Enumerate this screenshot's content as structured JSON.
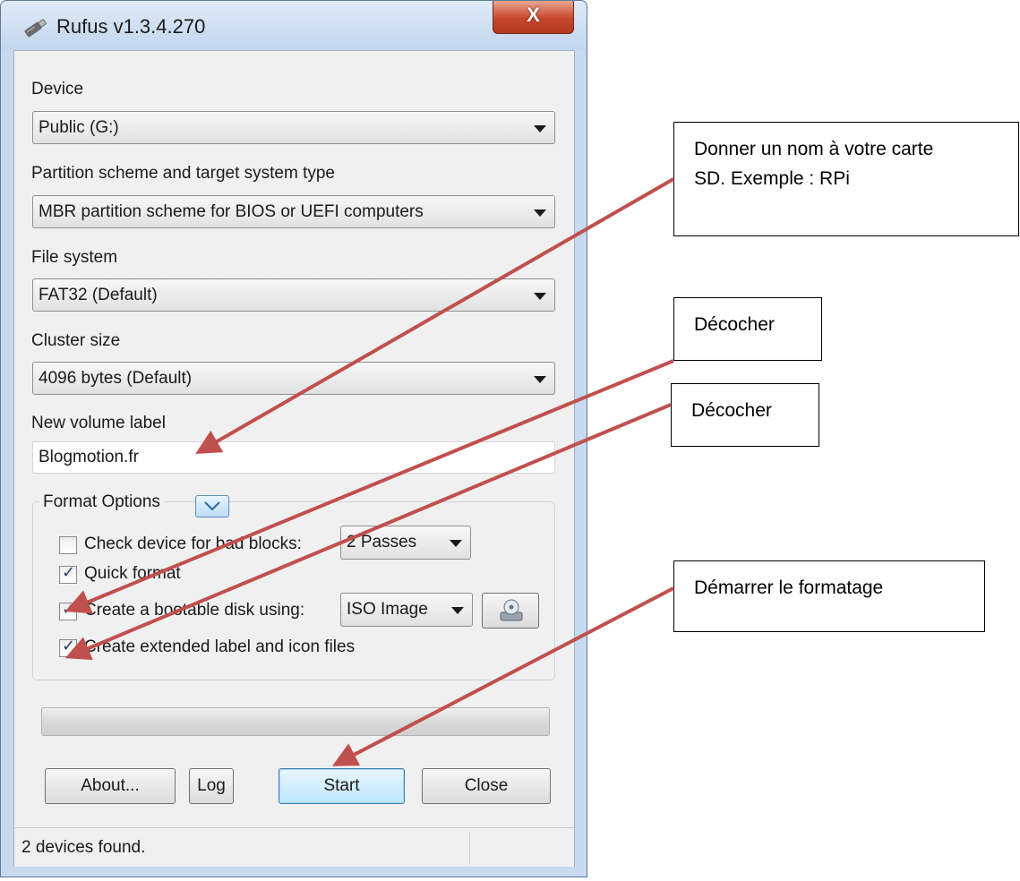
{
  "window": {
    "title": "Rufus v1.3.4.270",
    "close_glyph": "X"
  },
  "device": {
    "label": "Device",
    "value": "Public (G:)"
  },
  "partition": {
    "label": "Partition scheme and target system type",
    "value": "MBR partition scheme for BIOS or UEFI computers"
  },
  "filesystem": {
    "label": "File system",
    "value": "FAT32 (Default)"
  },
  "cluster": {
    "label": "Cluster size",
    "value": "4096 bytes (Default)"
  },
  "volume": {
    "label": "New volume label",
    "value": "Blogmotion.fr"
  },
  "format_options": {
    "title": "Format Options",
    "bad_blocks": {
      "label": "Check device for bad blocks:",
      "checked": false,
      "passes": "2 Passes"
    },
    "quick_format": {
      "label": "Quick format",
      "checked": true
    },
    "bootable": {
      "label": "Create a bootable disk using:",
      "checked": true,
      "source": "ISO Image"
    },
    "extended_label": {
      "label": "Create extended label and icon files",
      "checked": true
    }
  },
  "progress": {
    "value": 0
  },
  "buttons": {
    "about": "About...",
    "log": "Log",
    "start": "Start",
    "close": "Close"
  },
  "status": {
    "text": "2 devices found."
  },
  "annotations": {
    "volume_note_line1": "Donner un nom à votre carte",
    "volume_note_line2": "SD. Exemple : RPi",
    "uncheck_1": "Décocher",
    "uncheck_2": "Décocher",
    "start_note": "Démarrer le formatage",
    "arrow_color": "#c0504d"
  },
  "icons": {
    "title": "usb-drive-icon",
    "iso": "disc-drive-icon",
    "expand": "chevron-down-icon"
  }
}
